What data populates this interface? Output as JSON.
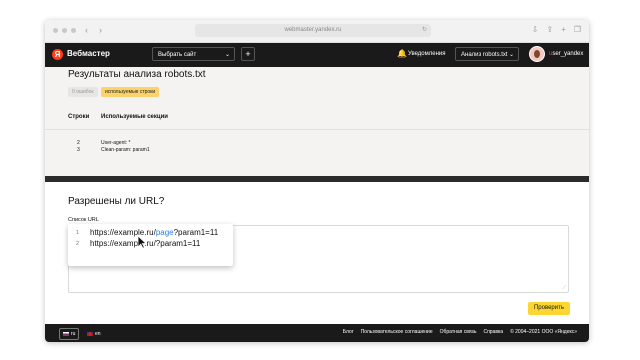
{
  "browser": {
    "url": "webmaster.yandex.ru"
  },
  "header": {
    "brand": "Вебмастер",
    "logo_letter": "Я",
    "site_select": "Выбрать сайт",
    "notifications": "Уведомления",
    "robots_select": "Анализ robots.txt",
    "username": "user_yandex"
  },
  "results": {
    "title": "Результаты анализа robots.txt",
    "tabs": [
      "0 ошибок",
      "используемые строки"
    ],
    "columns": [
      "Строки",
      "Используемые секции"
    ],
    "rows": [
      {
        "line": "2",
        "text": "User-agent: *"
      },
      {
        "line": "3",
        "text": "Clean-param: param1"
      }
    ]
  },
  "url_check": {
    "title": "Разрешены ли URL?",
    "list_label": "Список URL",
    "lines": [
      {
        "num": "1",
        "prefix": "https://example.ru/",
        "highlight": "page",
        "suffix": "?param1=11"
      },
      {
        "num": "2",
        "prefix": "https://example.ru/?param1=11",
        "highlight": "",
        "suffix": ""
      }
    ],
    "submit": "Проверить"
  },
  "footer": {
    "lang_ru": "ru",
    "lang_en": "en",
    "links": [
      "Блог",
      "Пользовательское соглашение",
      "Обратная связь",
      "Справка",
      "© 2004–2021 ООО «Яндекс»"
    ]
  },
  "colors": {
    "accent_yellow": "#fcd733",
    "link_blue": "#2f7de1",
    "yandex_red": "#fc3f1d",
    "topbar": "#1a1a1a"
  }
}
